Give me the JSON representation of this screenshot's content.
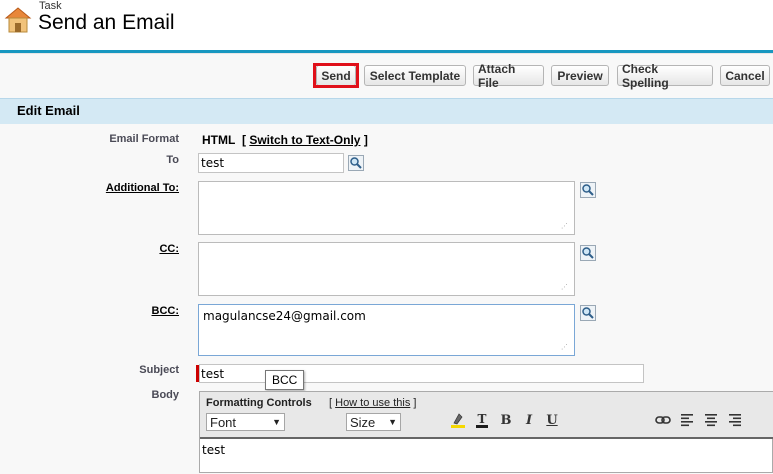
{
  "header": {
    "subtitle": "Task",
    "title": "Send an Email"
  },
  "buttons": {
    "send": "Send",
    "select_template": "Select Template",
    "attach_file": "Attach File",
    "preview": "Preview",
    "check_spelling": "Check Spelling",
    "cancel": "Cancel"
  },
  "section": {
    "title": "Edit Email"
  },
  "form": {
    "email_format_label": "Email Format",
    "email_format_value": "HTML",
    "bracket_open": "[",
    "switch_link": "Switch to Text-Only",
    "bracket_close": "]",
    "to_label": "To",
    "to_value": "test",
    "additional_to_label": "Additional To:",
    "additional_to_value": "",
    "cc_label": "CC:",
    "cc_value": "",
    "bcc_label": "BCC:",
    "bcc_value": "magulancse24@gmail.com",
    "subject_label": "Subject",
    "subject_value": "test",
    "body_label": "Body",
    "tooltip": "BCC"
  },
  "editor": {
    "formatting_title": "Formatting Controls",
    "help_open": "[",
    "help_link": "How to use this",
    "help_close": "]",
    "font_select": "Font",
    "size_select": "Size",
    "body_text": "test"
  },
  "colors": {
    "accent": "#1797c0",
    "highlight": "#e0101a",
    "section_bg": "#d4e9f4",
    "required": "#cc0000"
  }
}
